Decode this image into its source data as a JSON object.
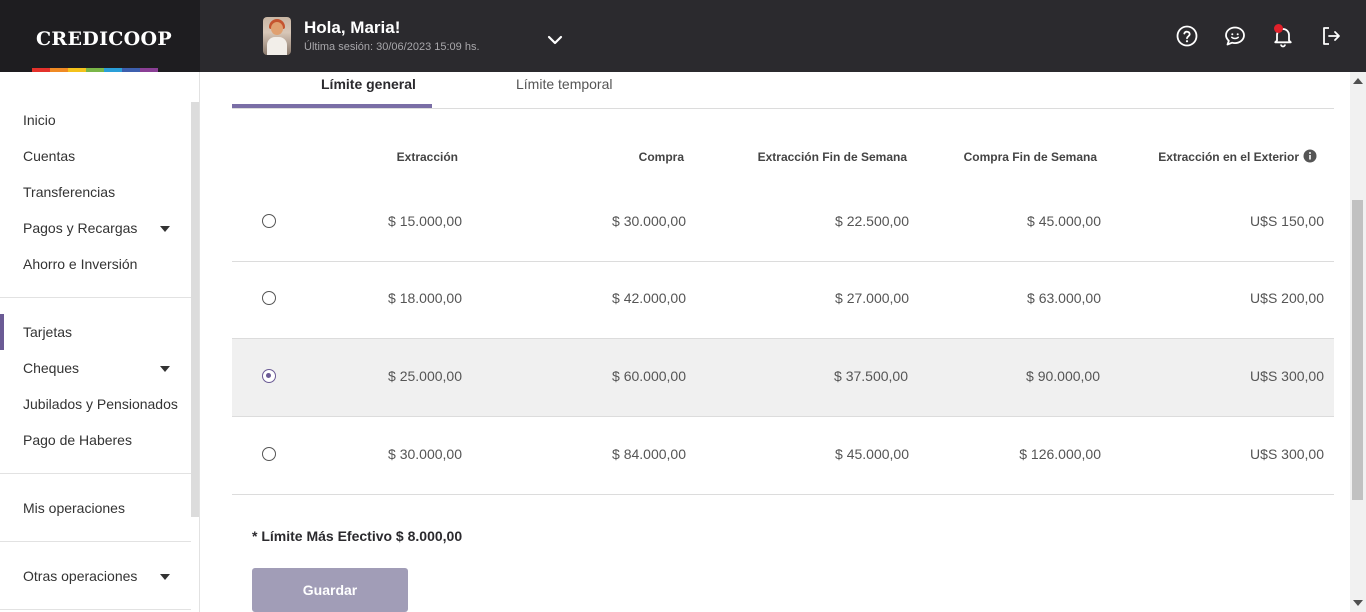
{
  "app": {
    "logo": "CREDICOOP",
    "rainbow_colors": [
      "#e4322b",
      "#f08a24",
      "#f4c21b",
      "#7ab648",
      "#2a9fd8",
      "#3d5fae",
      "#8a3f95"
    ]
  },
  "header": {
    "greeting": "Hola, Maria!",
    "last_session": "Última sesión: 30/06/2023 15:09 hs.",
    "icons": [
      "help-icon",
      "chat-icon",
      "bell-icon",
      "logout-icon"
    ]
  },
  "sidebar": {
    "items": [
      {
        "label": "Inicio"
      },
      {
        "label": "Cuentas"
      },
      {
        "label": "Transferencias"
      },
      {
        "label": "Pagos y Recargas"
      },
      {
        "label": "Ahorro e Inversión"
      },
      {
        "label": "Tarjetas"
      },
      {
        "label": "Cheques"
      },
      {
        "label": "Jubilados y Pensionados"
      },
      {
        "label": "Pago de Haberes"
      },
      {
        "label": "Mis operaciones"
      },
      {
        "label": "Otras operaciones"
      }
    ],
    "active": "Tarjetas",
    "accent": "#6b5b95"
  },
  "tabs": [
    {
      "label": "Límite general",
      "active": true
    },
    {
      "label": "Límite temporal",
      "active": false
    }
  ],
  "table": {
    "headers": [
      "Extracción",
      "Compra",
      "Extracción Fin de Semana",
      "Compra Fin de Semana",
      "Extracción en el Exterior"
    ],
    "rows": [
      {
        "selected": false,
        "values": [
          "$ 15.000,00",
          "$ 30.000,00",
          "$ 22.500,00",
          "$ 45.000,00",
          "U$S 150,00"
        ]
      },
      {
        "selected": false,
        "values": [
          "$ 18.000,00",
          "$ 42.000,00",
          "$ 27.000,00",
          "$ 63.000,00",
          "U$S 200,00"
        ]
      },
      {
        "selected": true,
        "values": [
          "$ 25.000,00",
          "$ 60.000,00",
          "$ 37.500,00",
          "$ 90.000,00",
          "U$S 300,00"
        ]
      },
      {
        "selected": false,
        "values": [
          "$ 30.000,00",
          "$ 84.000,00",
          "$ 45.000,00",
          "$ 126.000,00",
          "U$S 300,00"
        ]
      }
    ]
  },
  "footnote": "* Límite Más Efectivo $ 8.000,00",
  "save_label": "Guardar"
}
